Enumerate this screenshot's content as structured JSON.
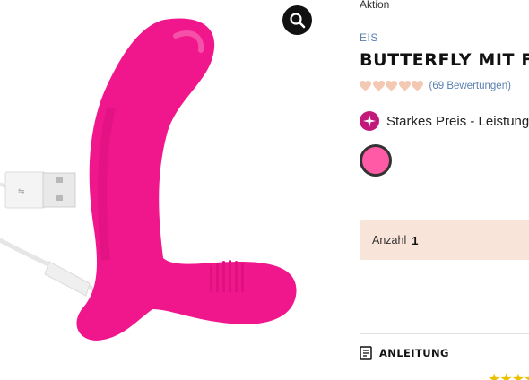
{
  "gallery": {
    "zoom_icon": "magnifier-icon",
    "product_color": "#f0178d"
  },
  "product": {
    "badge": "Aktion",
    "brand": "EIS",
    "title": "BUTTERFLY MIT FERN",
    "rating": {
      "filled_hearts": 5,
      "max": 5,
      "heart_color": "#f4c9b4",
      "reviews_label": "(69 Bewertungen)"
    },
    "promo": {
      "icon": "sparkle-icon",
      "text": "Starkes Preis - Leistung"
    },
    "color_swatch": {
      "color": "#ff5aa6",
      "selected": true
    },
    "quantity": {
      "label": "Anzahl",
      "value": "1"
    },
    "manual": {
      "icon": "document-icon",
      "label": "ANLEITUNG"
    },
    "bottom_stars": "★★★★"
  }
}
